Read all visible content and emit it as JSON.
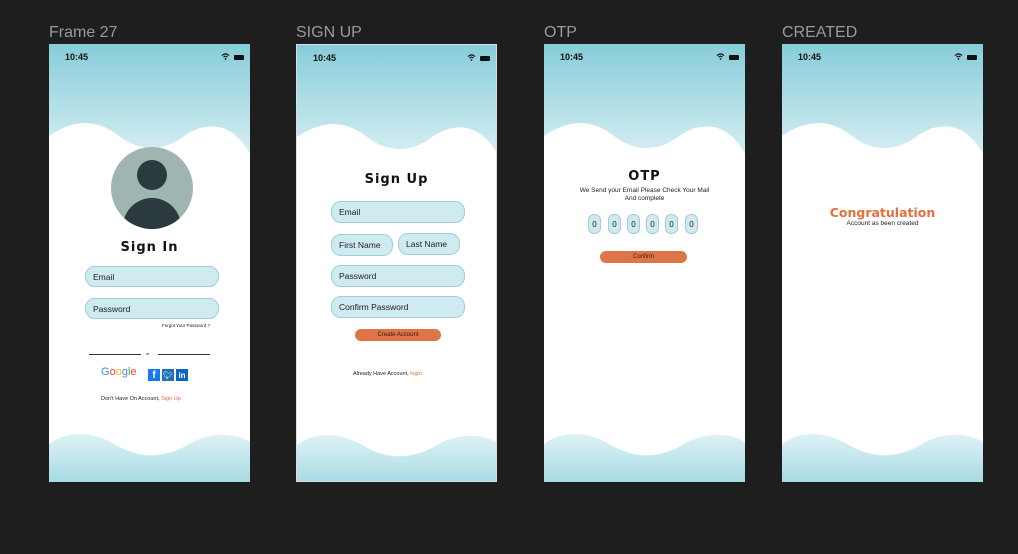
{
  "frames": {
    "signin": {
      "label": "Frame 27"
    },
    "signup": {
      "label": "SIGN UP"
    },
    "otp": {
      "label": "OTP"
    },
    "created": {
      "label": "CREATED"
    }
  },
  "status": {
    "time": "10:45"
  },
  "signin": {
    "title": "Sign In",
    "email_placeholder": "Email",
    "password_placeholder": "Password",
    "forgot": "Forgot Your Password ?",
    "or": "or",
    "google": "Google",
    "social_icons": [
      "facebook-icon",
      "twitter-icon",
      "linkedin-icon"
    ],
    "no_account": "Don't  Have On Account,",
    "signup_link": "Sign Up"
  },
  "signup": {
    "title": "Sign Up",
    "email": "Email",
    "first_name": "First Name",
    "last_name": "Last Name",
    "password": "Password",
    "confirm_password": "Confirm Password",
    "create_button": "Create Account",
    "have_account": "Already Have Account,",
    "login_link": "login"
  },
  "otp": {
    "title": "OTP",
    "message_line1": "We Send your Email Please Check Your Mail",
    "message_line2": "And complete",
    "digits": [
      "0",
      "0",
      "0",
      "0",
      "0",
      "0"
    ],
    "confirm_button": "Confirm"
  },
  "created": {
    "title": "Congratulation",
    "message": "Account as been created"
  },
  "colors": {
    "accent": "#e2703e",
    "wave": "#a9dce5",
    "field": "#cfeaf0",
    "button": "#dd7548"
  }
}
